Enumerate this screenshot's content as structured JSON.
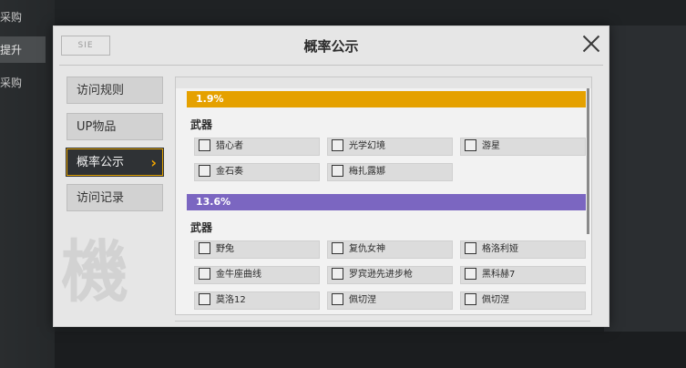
{
  "background": {
    "left_items": [
      "采购",
      "提升",
      "采购"
    ]
  },
  "modal": {
    "title": "概率公示",
    "logo_text": "SIE"
  },
  "tabs": [
    {
      "label": "访问规则"
    },
    {
      "label": "UP物品"
    },
    {
      "label": "概率公示"
    },
    {
      "label": "访问记录"
    }
  ],
  "watermark_char": "機",
  "content": {
    "groups": [
      {
        "rate": "1.9%",
        "color": "#e5a100",
        "section": "武器",
        "items": [
          "猎心者",
          "光学幻境",
          "游星",
          "金石奏",
          "梅扎露娜"
        ]
      },
      {
        "rate": "13.6%",
        "color": "#7b66c1",
        "section": "武器",
        "items": [
          "野兔",
          "复仇女神",
          "格洛利娅",
          "金牛座曲线",
          "罗宾逊先进步枪",
          "黑科赫7",
          "莫洛12",
          "佩切涅",
          "佩切涅"
        ]
      }
    ]
  }
}
